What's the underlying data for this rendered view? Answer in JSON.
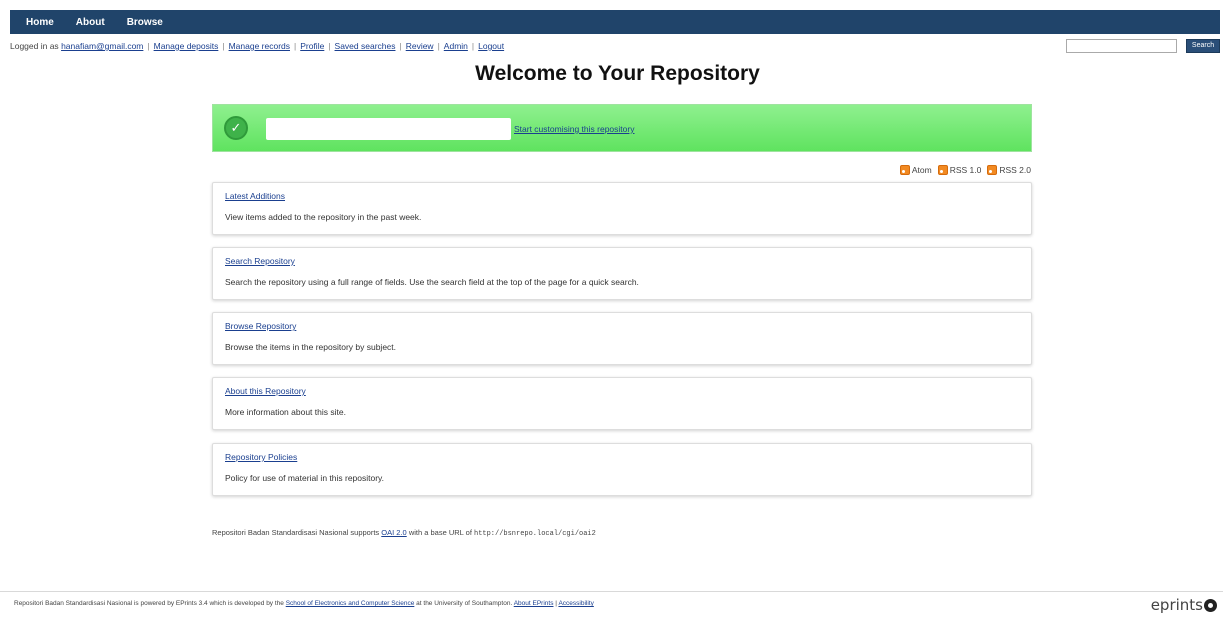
{
  "topnav": {
    "items": [
      "Home",
      "About",
      "Browse"
    ]
  },
  "userbar": {
    "logged_in_prefix": "Logged in as",
    "email": "hanafiam@gmail.com",
    "links": [
      "Manage deposits",
      "Manage records",
      "Profile",
      "Saved searches",
      "Review",
      "Admin",
      "Logout"
    ],
    "search_placeholder": "",
    "search_button": "Search"
  },
  "page_title": "Welcome to Your Repository",
  "banner": {
    "link_text": "Start customising this repository"
  },
  "feeds": [
    {
      "label": "Atom",
      "icon": "rss-icon"
    },
    {
      "label": "RSS 1.0",
      "icon": "rss-icon"
    },
    {
      "label": "RSS 2.0",
      "icon": "rss-icon"
    }
  ],
  "cards": [
    {
      "title": "Latest Additions",
      "desc": "View items added to the repository in the past week."
    },
    {
      "title": "Search Repository",
      "desc": "Search the repository using a full range of fields. Use the search field at the top of the page for a quick search."
    },
    {
      "title": "Browse Repository",
      "desc": "Browse the items in the repository by subject."
    },
    {
      "title": "About this Repository",
      "desc": "More information about this site."
    },
    {
      "title": "Repository Policies",
      "desc": "Policy for use of material in this repository."
    }
  ],
  "oai": {
    "prefix": "Repositori Badan Standardisasi Nasional supports",
    "link": "OAI 2.0",
    "middle": "with a base URL of",
    "url": "http://bsnrepo.local/cgi/oai2"
  },
  "footer": {
    "prefix": "Repositori Badan Standardisasi Nasional is powered by EPrints 3.4 which is developed by the",
    "school_link": "School of Electronics and Computer Science",
    "middle": "at the University of Southampton.",
    "about_link": "About EPrints",
    "separator": "|",
    "accessibility_link": "Accessibility"
  },
  "logo_text": "eprints",
  "colors": {
    "nav_bg": "#20446a",
    "banner_green": "#6ae86a",
    "link": "#1a3f8f",
    "rss_orange": "#f28a22"
  }
}
